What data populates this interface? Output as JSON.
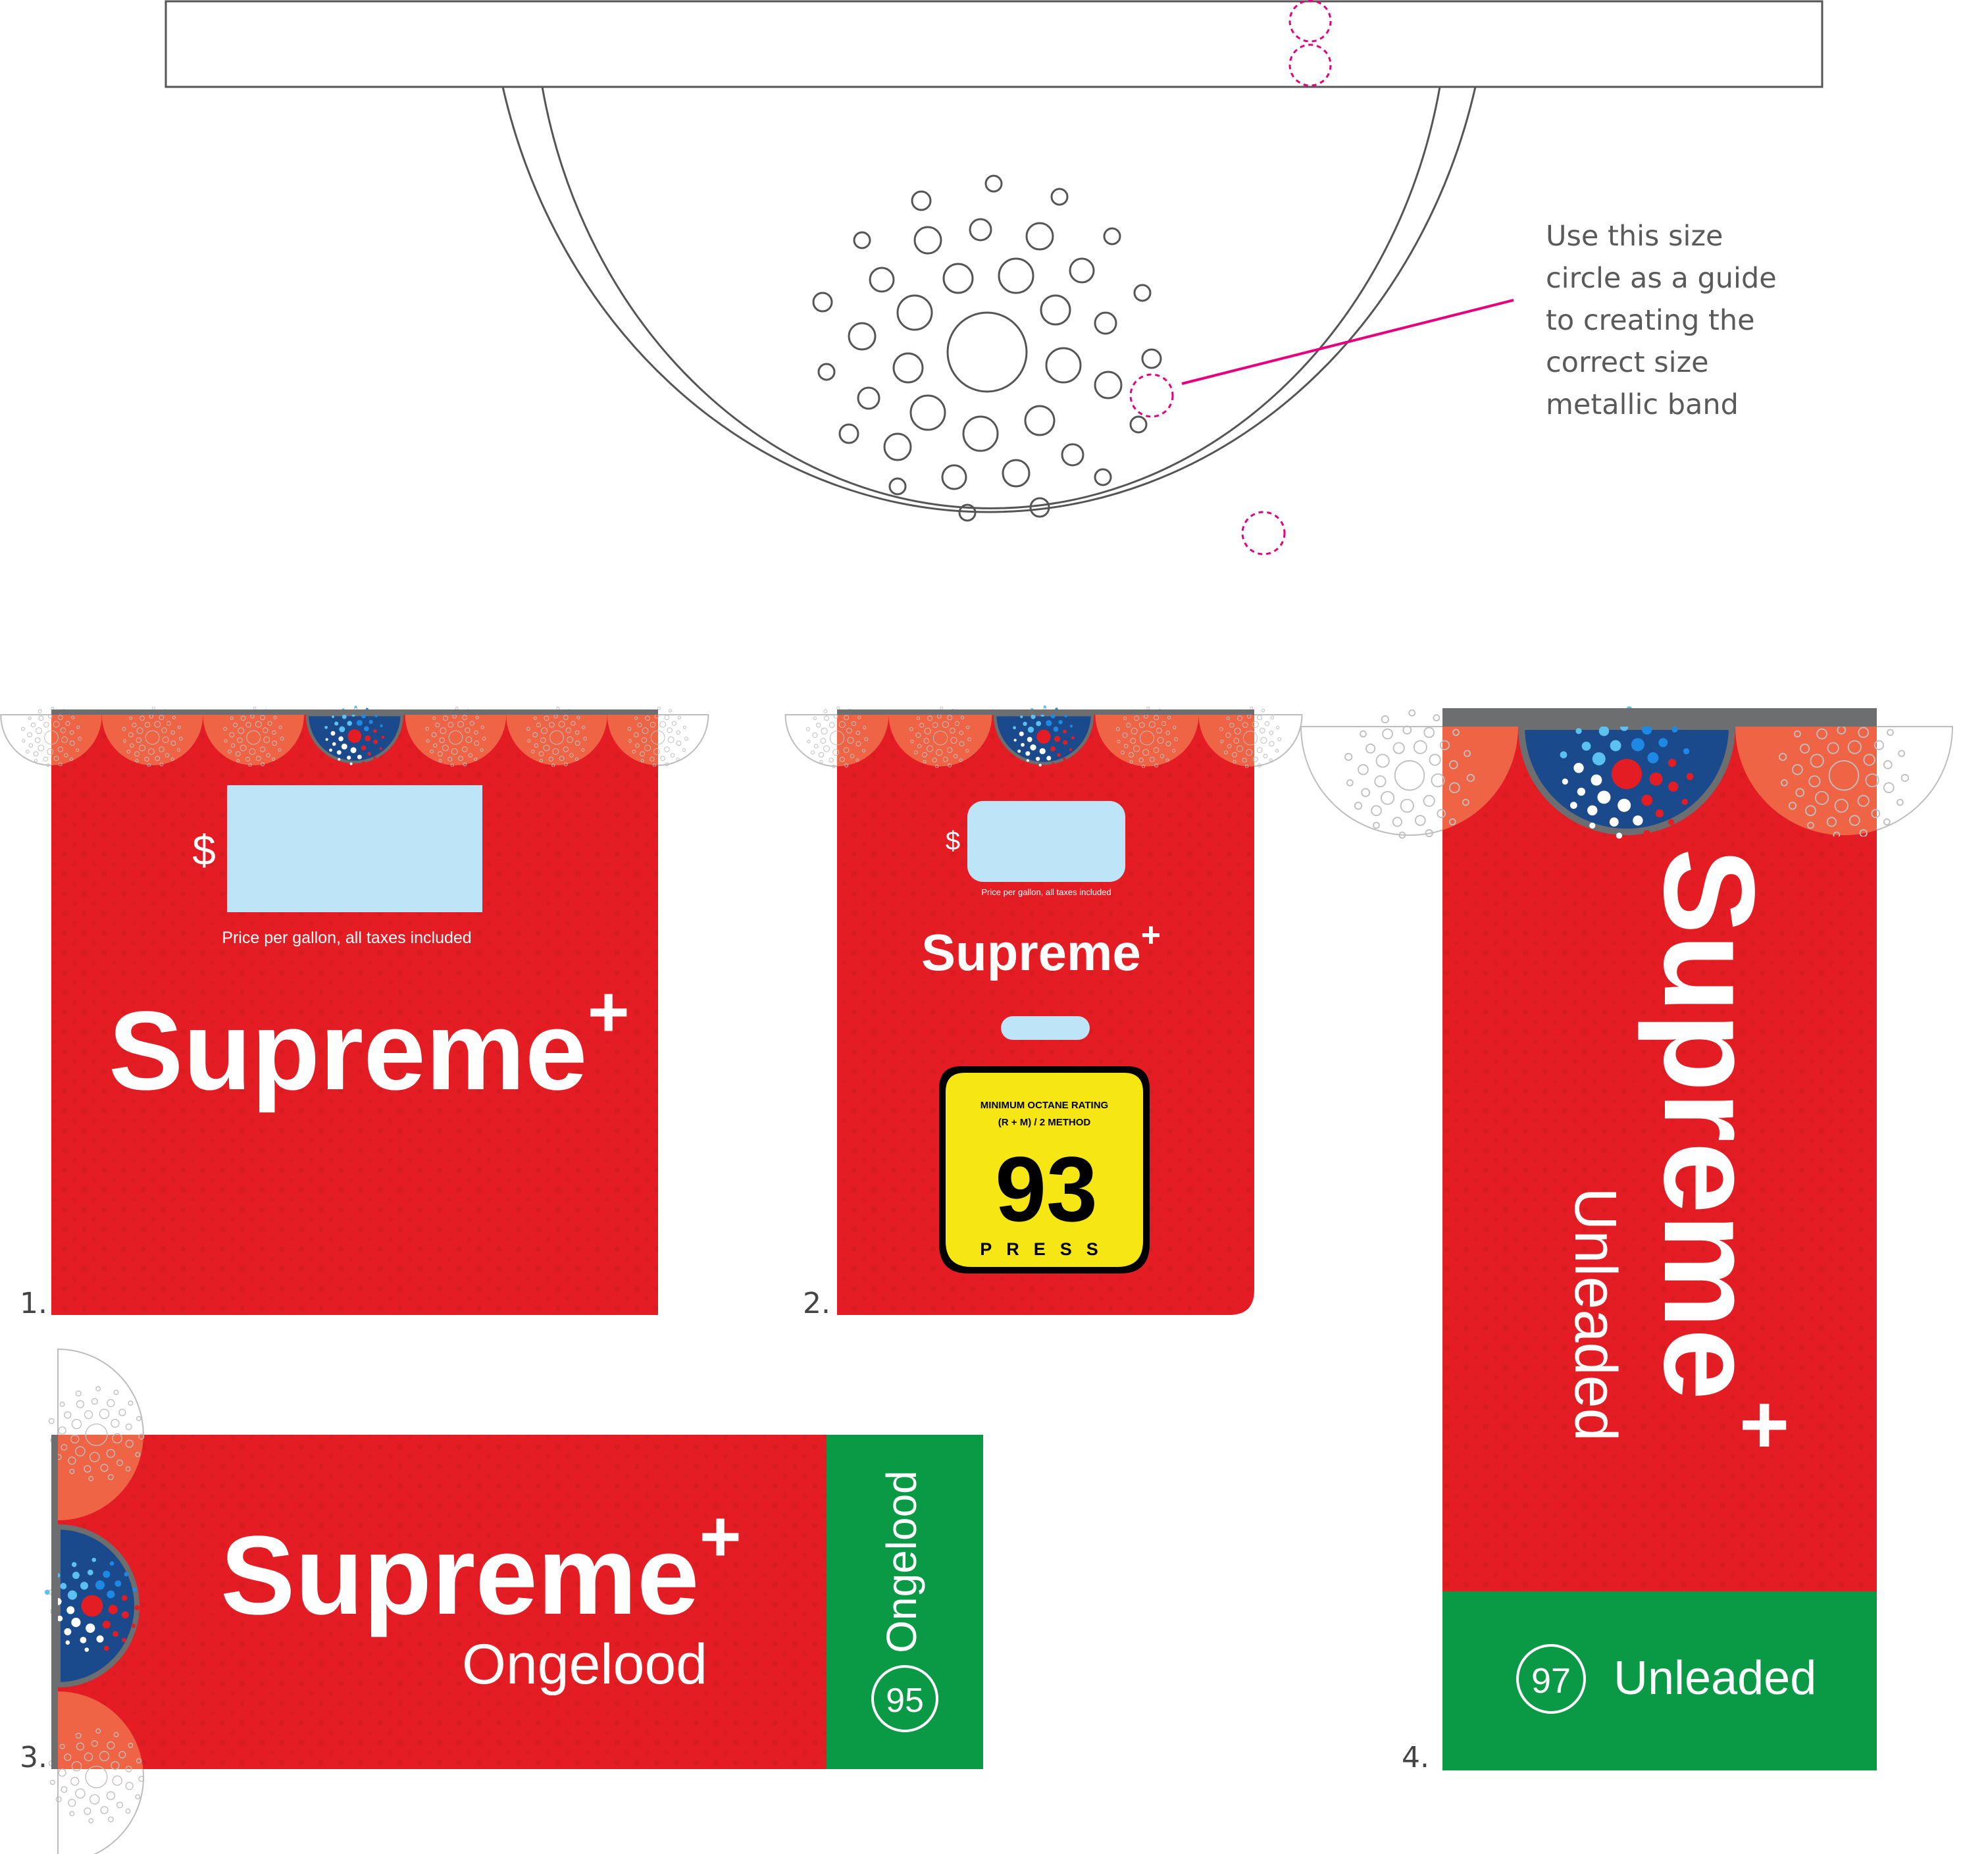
{
  "top_diagram": {
    "guide_note": [
      "Use this size",
      "circle as a guide",
      "to creating the",
      "correct size",
      "metallic band"
    ]
  },
  "panels": [
    {
      "number": "1.",
      "currency_symbol": "$",
      "price_caption": "Price per gallon, all taxes included",
      "brand": "Supreme",
      "brand_plus": "+"
    },
    {
      "number": "2.",
      "currency_symbol": "$",
      "price_caption": "Price per gallon, all taxes included",
      "brand": "Supreme",
      "brand_plus": "+",
      "octane_label": {
        "line1": "MINIMUM OCTANE RATING",
        "line2": "(R + M) / 2 METHOD",
        "value": "93",
        "press": "PRESS"
      }
    },
    {
      "number": "3.",
      "brand": "Supreme",
      "brand_plus": "+",
      "subtitle": "Ongelood",
      "side_text": "Ongelood",
      "grade": "95"
    },
    {
      "number": "4.",
      "brand": "Supreme",
      "brand_plus": "+",
      "subtitle": "Unleaded",
      "footer_text": "Unleaded",
      "grade": "97"
    }
  ],
  "colors": {
    "red": "#e31d23",
    "orange_scallop": "#f06a48",
    "green": "#0a9a45",
    "navy": "#1b4a8c",
    "light_blue": "#bde5f7",
    "yellow": "#f5e614",
    "grey_band": "#6d6e70",
    "magenta": "#e6007e",
    "outline": "#555555"
  }
}
